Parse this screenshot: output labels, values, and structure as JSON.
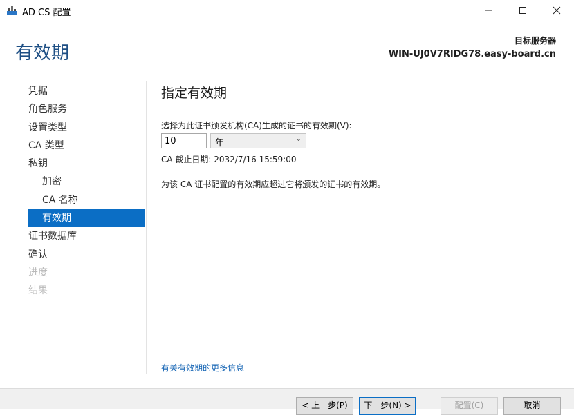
{
  "window": {
    "title": "AD CS 配置"
  },
  "header": {
    "page_title": "有效期",
    "server_label": "目标服务器",
    "server_name": "WIN-UJ0V7RIDG78.easy-board.cn"
  },
  "nav": {
    "items": [
      {
        "label": "凭据",
        "state": "normal"
      },
      {
        "label": "角色服务",
        "state": "normal"
      },
      {
        "label": "设置类型",
        "state": "normal"
      },
      {
        "label": "CA 类型",
        "state": "normal"
      },
      {
        "label": "私钥",
        "state": "normal"
      },
      {
        "label": "加密",
        "state": "sub"
      },
      {
        "label": "CA 名称",
        "state": "sub"
      },
      {
        "label": "有效期",
        "state": "selected"
      },
      {
        "label": "证书数据库",
        "state": "normal"
      },
      {
        "label": "确认",
        "state": "normal"
      },
      {
        "label": "进度",
        "state": "disabled"
      },
      {
        "label": "结果",
        "state": "disabled"
      }
    ]
  },
  "content": {
    "section_title": "指定有效期",
    "prompt": "选择为此证书颁发机构(CA)生成的证书的有效期(V):",
    "validity_value": "10",
    "validity_unit": "年",
    "expiry": "CA 截止日期: 2032/7/16 15:59:00",
    "note": "为该 CA 证书配置的有效期应超过它将颁发的证书的有效期。",
    "more_link": "有关有效期的更多信息"
  },
  "footer": {
    "prev": "< 上一步(P)",
    "next": "下一步(N) >",
    "config": "配置(C)",
    "cancel": "取消"
  },
  "colors": {
    "accent": "#0b6ec5",
    "heading": "#1e4f84",
    "link": "#1464b4"
  }
}
